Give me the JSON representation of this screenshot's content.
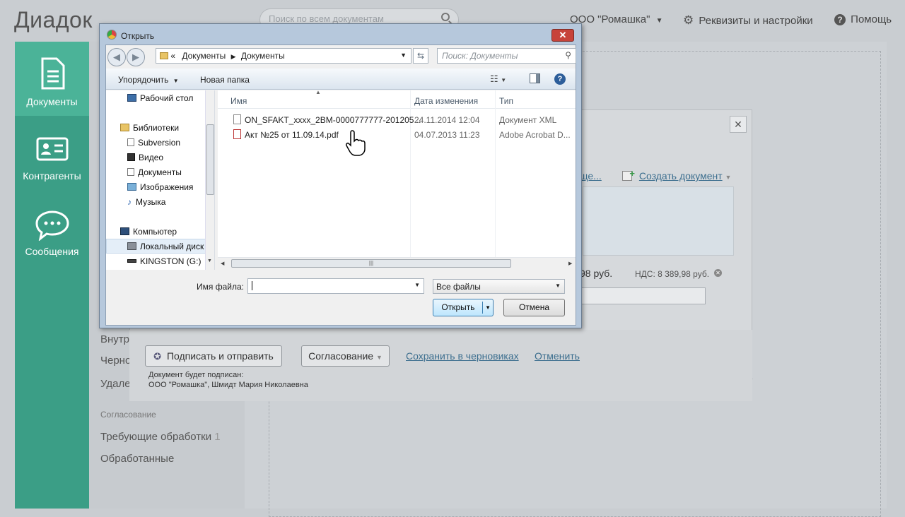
{
  "app": {
    "logo": "Диадок",
    "search_placeholder": "Поиск по всем документам",
    "org": "ООО \"Ромашка\"",
    "settings": "Реквизиты и настройки",
    "help": "Помощь"
  },
  "leftnav": {
    "items": [
      {
        "label": "Документы"
      },
      {
        "label": "Контрагенты"
      },
      {
        "label": "Сообщения"
      }
    ]
  },
  "subpanel": {
    "items": [
      "Внутр",
      "Черно",
      "Удале"
    ],
    "section": "Согласование",
    "pending": "Требующие обработки",
    "pending_count": "1",
    "processed": "Обработанные"
  },
  "bgdialog": {
    "link_partial": "ще...",
    "create_doc": "Создать документ",
    "amount_partial": "98 руб.",
    "vat": "НДС: 8 389,98 руб.",
    "sign_send": "Подписать и отправить",
    "approval": "Согласование",
    "save_draft": "Сохранить в черновиках",
    "cancel": "Отменить",
    "signed_by_line1": "Документ будет подписан:",
    "signed_by_line2": "ООО \"Ромашка\", Шмидт Мария Николаевна"
  },
  "filedialog": {
    "title": "Открыть",
    "path": [
      "Документы",
      "Документы"
    ],
    "search_placeholder": "Поиск: Документы",
    "organize": "Упорядочить",
    "new_folder": "Новая папка",
    "tree": {
      "desktop": "Рабочий стол",
      "libraries": "Библиотеки",
      "subversion": "Subversion",
      "video": "Видео",
      "documents": "Документы",
      "images": "Изображения",
      "music": "Музыка",
      "computer": "Компьютер",
      "local_disk": "Локальный диск",
      "kingston": "KINGSTON (G:)"
    },
    "columns": {
      "name": "Имя",
      "date": "Дата изменения",
      "type": "Тип"
    },
    "files": [
      {
        "name": "ON_SFAKT_xxxx_2BM-0000777777-201205...",
        "date": "24.11.2014 12:04",
        "type": "Документ XML"
      },
      {
        "name": "Акт №25 от 11.09.14.pdf",
        "date": "04.07.2013 11:23",
        "type": "Adobe Acrobat D..."
      }
    ],
    "filename_label": "Имя файла:",
    "filename_value": "",
    "filter": "Все файлы",
    "open": "Открыть",
    "cancel": "Отмена"
  }
}
